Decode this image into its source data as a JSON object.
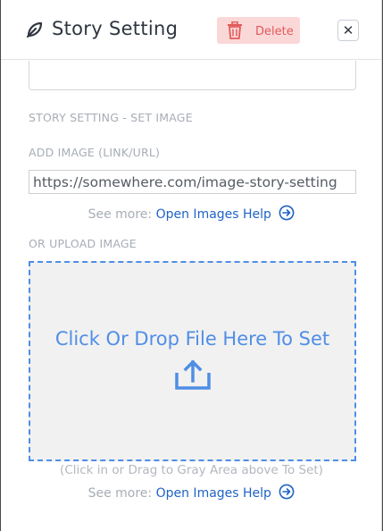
{
  "header": {
    "title": "Story Setting",
    "title_icon": "edit-icon",
    "delete_label": "Delete",
    "delete_icon": "trash-icon",
    "close_glyph": "✕"
  },
  "section": {
    "heading": "STORY SETTING - SET IMAGE",
    "add_image_label": "ADD IMAGE (LINK/URL)",
    "url_value": "https://somewhere.com/image-story-setting",
    "see_more_prefix": "See more:",
    "see_more_link": "Open Images Help",
    "upload_label": "OR UPLOAD IMAGE",
    "drop_text": "Click Or Drop File Here To Set",
    "drop_hint": "(Click in or Drag to Gray Area above To Set)",
    "see_more_prefix_2": "See more:",
    "see_more_link_2": "Open Images Help"
  },
  "colors": {
    "delete_bg": "#fbd8d8",
    "delete_text": "#e25a5a",
    "link": "#1f63c6",
    "drop_accent": "#4f8ee6",
    "drop_bg": "#f1f1f1"
  }
}
